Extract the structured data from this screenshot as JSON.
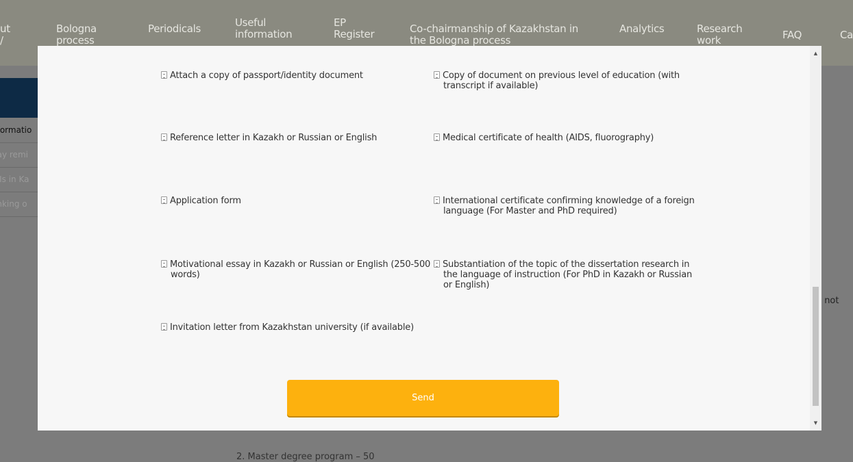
{
  "background": {
    "nav": [
      {
        "label": "ut\n/"
      },
      {
        "label": "Bologna\nprocess"
      },
      {
        "label": "Periodicals"
      },
      {
        "label": "Useful\ninformation"
      },
      {
        "label": "EP\nRegister"
      },
      {
        "label": "Co-chairmanship of Kazakhstan in\nthe Bologna process"
      },
      {
        "label": "Analytics"
      },
      {
        "label": "Research\nwork"
      },
      {
        "label": "FAQ"
      },
      {
        "label": "Ca"
      }
    ],
    "sidebar": [
      {
        "label": "nformatio"
      },
      {
        "label": "day remi"
      },
      {
        "label": "IEIs in Ka"
      },
      {
        "label": "anking o"
      }
    ],
    "right_text": "re not",
    "bottom_text": "2. Master degree program – 50"
  },
  "modal": {
    "documents": [
      {
        "label": "Attach a copy of passport/identity document"
      },
      {
        "label": "Copy of document on previous level of education (with",
        "label2": "transcript if available)"
      },
      {
        "label": "Reference letter in Kazakh or Russian or English"
      },
      {
        "label": "Medical certificate of health (AIDS, fluorography)"
      },
      {
        "label": "Application form"
      },
      {
        "label": "International certificate confirming knowledge of a foreign",
        "label2": "language (For Master and PhD required)"
      },
      {
        "label": "Motivational essay in Kazakh or Russian or English (250-500",
        "label2": "words)"
      },
      {
        "label": "Substantiation of the topic of the dissertation research in",
        "label2": "the language of instruction (For PhD in Kazakh or Russian",
        "label3": "or English)"
      },
      {
        "label": "Invitation letter from Kazakhstan university (if available)"
      }
    ],
    "send_label": "Send"
  },
  "colors": {
    "send_button": "#fdb10e",
    "modal_bg": "#f7f7f7",
    "sidebar_active": "#0d2a45"
  }
}
